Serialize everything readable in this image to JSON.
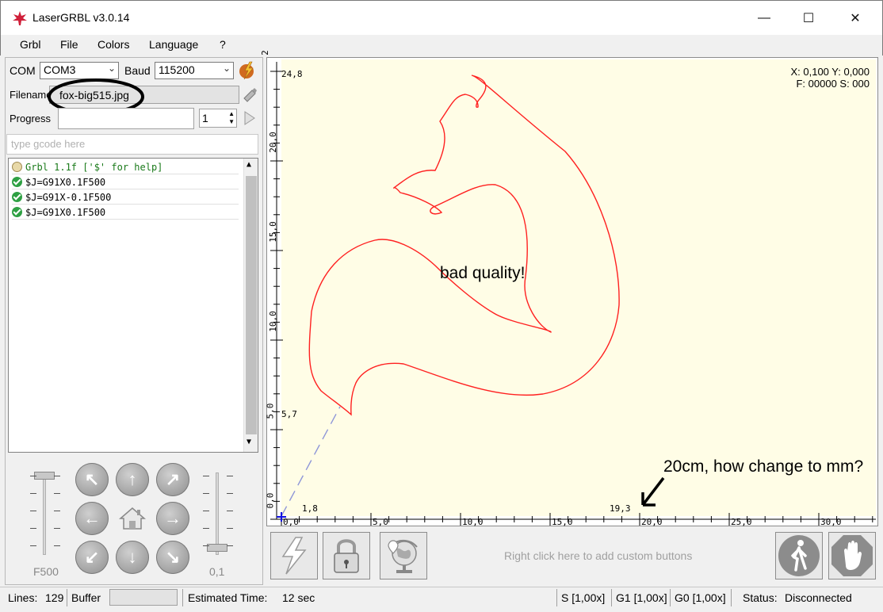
{
  "window": {
    "title": "LaserGRBL v3.0.14",
    "minimize": "—",
    "maximize": "☐",
    "close": "✕"
  },
  "menu": [
    "Grbl",
    "File",
    "Colors",
    "Language",
    "?"
  ],
  "connection": {
    "com_label": "COM",
    "com_value": "COM3",
    "baud_label": "Baud",
    "baud_value": "115200"
  },
  "file": {
    "filename_label": "Filename",
    "filename_value": "fox-big515.jpg",
    "progress_label": "Progress",
    "copies_value": "1"
  },
  "gcode_input": {
    "placeholder": "type gcode here"
  },
  "log": [
    {
      "icon": "info-icon",
      "text": "Grbl 1.1f ['$' for help]",
      "color": "#1a7a1a"
    },
    {
      "icon": "ok-icon",
      "text": "$J=G91X0.1F500",
      "color": "#000000"
    },
    {
      "icon": "ok-icon",
      "text": "$J=G91X-0.1F500",
      "color": "#000000"
    },
    {
      "icon": "ok-icon",
      "text": "$J=G91X0.1F500",
      "color": "#000000"
    }
  ],
  "jog": {
    "speed_label": "F500",
    "step_label": "0,1",
    "speed_fraction": 1.0,
    "step_fraction": 0.0
  },
  "canvas": {
    "coords_line1": "X: 0,100 Y: 0,000",
    "coords_line2": "F: 00000 S: 000",
    "y_ticks": [
      "0,0",
      "5,0",
      "10,0",
      "15,0",
      "20,0",
      "2"
    ],
    "x_ticks": [
      "0,0",
      "5,0",
      "10,0",
      "15,0",
      "20,0",
      "25,0",
      "30,0"
    ],
    "bbox_top": "24,8",
    "bbox_bottom_y": "5,7",
    "bbox_left_x": "1,8",
    "bbox_right_x": "19,3",
    "annotation_quality": "bad quality!",
    "annotation_units": "20cm, how change to mm?",
    "drawing_color": "#ff2020",
    "background_color": "#fffde6"
  },
  "toolbar": {
    "custom_hint": "Right click here to add custom buttons"
  },
  "status": {
    "lines_label": "Lines:",
    "lines_value": "129",
    "buffer_label": "Buffer",
    "estimated_label": "Estimated Time:",
    "estimated_value": "12 sec",
    "s_override": "S [1,00x]",
    "g1_override": "G1 [1,00x]",
    "g0_override": "G0 [1,00x]",
    "status_label": "Status:",
    "status_value": "Disconnected"
  }
}
